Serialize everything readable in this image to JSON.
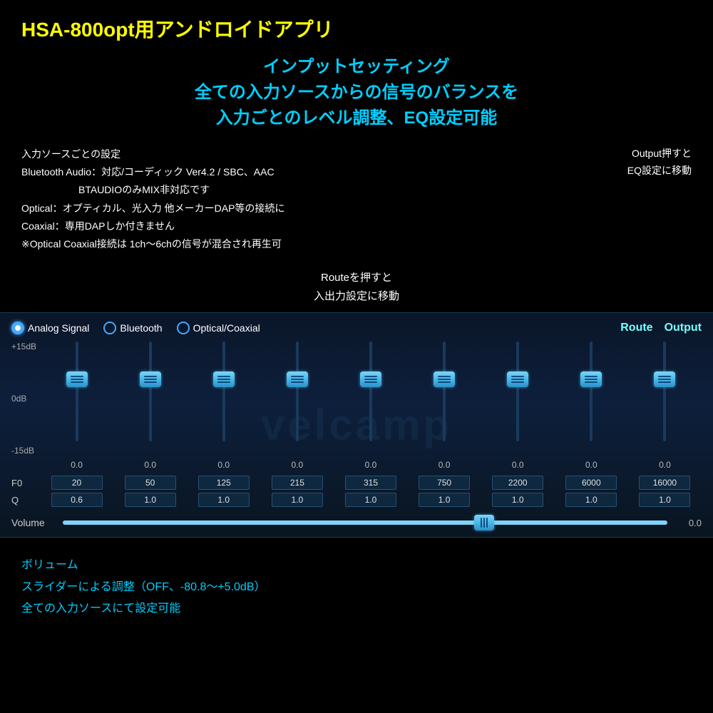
{
  "app": {
    "title": "HSA-800opt用アンドロイドアプリ",
    "subtitle_line1": "インプットセッティング",
    "subtitle_line2": "全ての入力ソースからの信号のバランスを",
    "subtitle_line3": "入力ごとのレベル調整、EQ設定可能"
  },
  "info": {
    "line1": "入力ソースごとの設定",
    "line2": "Bluetooth Audio：対応/コーディック Ver4.2 / SBC、AAC",
    "line3": "BTAUDIOのみMIX非対応です",
    "line4": "Optical：オプティカル、光入力 他メーカーDAP等の接続に",
    "line5": "Coaxial：専用DAPしか付きません",
    "line6": "※Optical Coaxial接続は 1ch〜6chの信号が混合され再生可",
    "output_note_line1": "Output押すと",
    "output_note_line2": "EQ設定に移動",
    "route_note_line1": "Routeを押すと",
    "route_note_line2": "入出力設定に移動"
  },
  "eq_panel": {
    "signal_sources": [
      {
        "label": "Analog Signal",
        "active": true
      },
      {
        "label": "Bluetooth",
        "active": false
      },
      {
        "label": "Optical/Coaxial",
        "active": false
      }
    ],
    "route_btn": "Route",
    "output_btn": "Output",
    "db_labels": {
      "top": "+15dB",
      "mid": "0dB",
      "bot": "-15dB"
    },
    "sliders": [
      {
        "db_value": "0.0",
        "f0": "20",
        "q": "0.6"
      },
      {
        "db_value": "0.0",
        "f0": "50",
        "q": "1.0"
      },
      {
        "db_value": "0.0",
        "f0": "125",
        "q": "1.0"
      },
      {
        "db_value": "0.0",
        "f0": "215",
        "q": "1.0"
      },
      {
        "db_value": "0.0",
        "f0": "315",
        "q": "1.0"
      },
      {
        "db_value": "0.0",
        "f0": "750",
        "q": "1.0"
      },
      {
        "db_value": "0.0",
        "f0": "2200",
        "q": "1.0"
      },
      {
        "db_value": "0.0",
        "f0": "6000",
        "q": "1.0"
      },
      {
        "db_value": "0.0",
        "f0": "16000",
        "q": "1.0"
      }
    ],
    "f0_label": "F0",
    "q_label": "Q",
    "volume_label": "Volume",
    "volume_value": "0.0",
    "watermark": "velcamp"
  },
  "bottom": {
    "line1": "ボリューム",
    "line2": "スライダーによる調整（OFF、-80.8〜+5.0dB）",
    "line3": "全ての入力ソースにて設定可能"
  }
}
